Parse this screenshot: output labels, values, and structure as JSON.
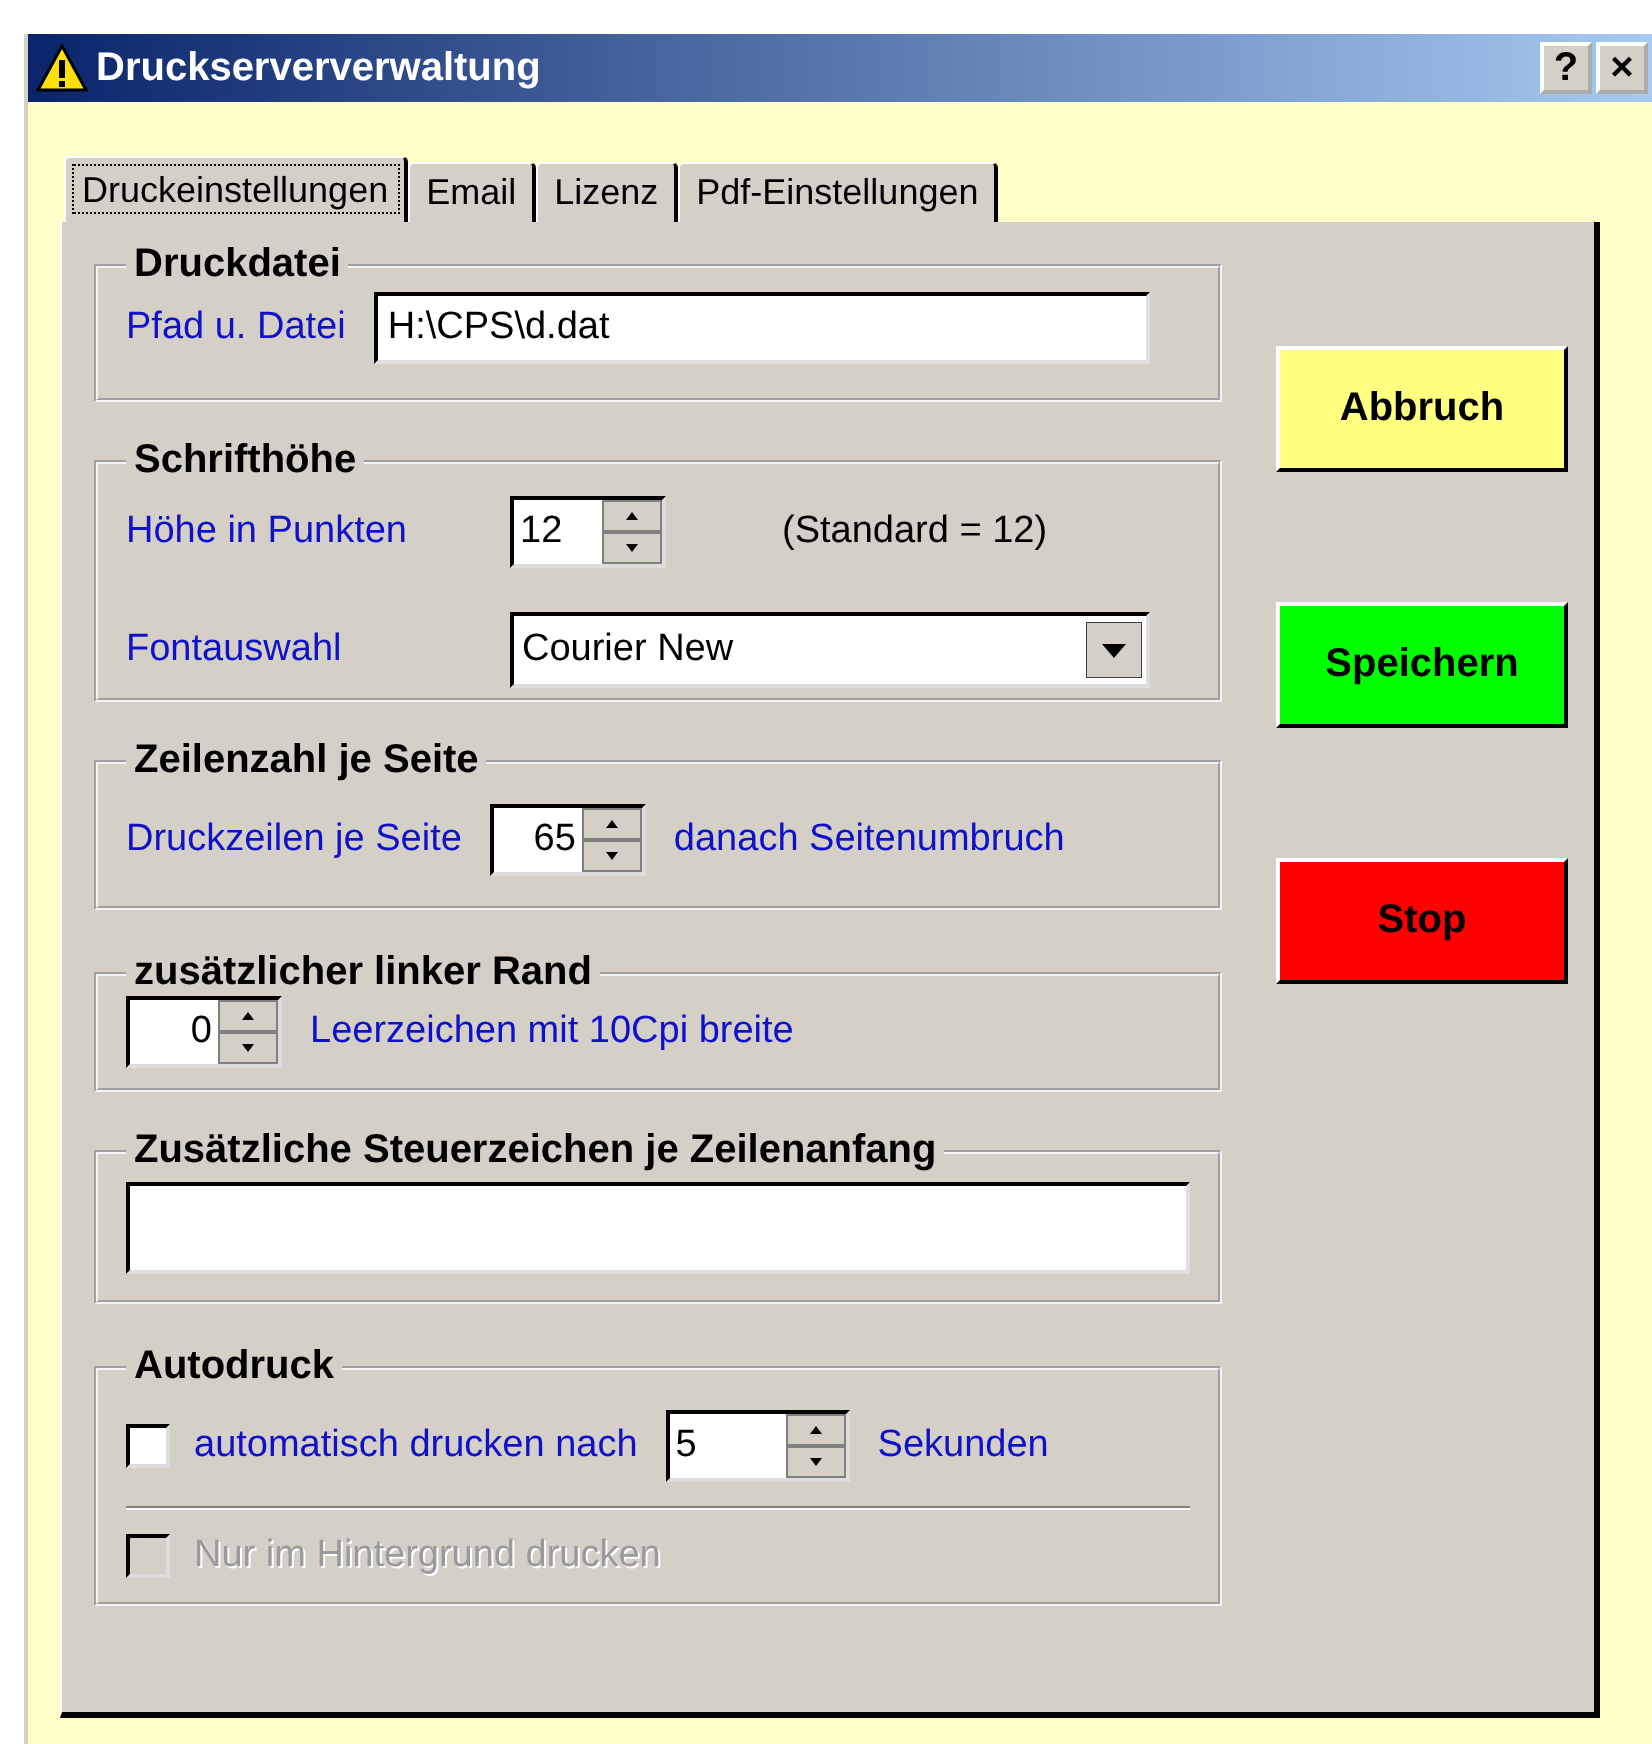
{
  "window": {
    "title": "Druckserververwaltung",
    "help": "?",
    "close": "×"
  },
  "tabs": [
    {
      "label": "Druckeinstellungen",
      "selected": true
    },
    {
      "label": "Email",
      "selected": false
    },
    {
      "label": "Lizenz",
      "selected": false
    },
    {
      "label": "Pdf-Einstellungen",
      "selected": false
    }
  ],
  "druckdatei": {
    "title": "Druckdatei",
    "label": "Pfad u. Datei",
    "value": "H:\\CPS\\d.dat"
  },
  "schrifthoehe": {
    "title": "Schrifthöhe",
    "size_label": "Höhe in Punkten",
    "size_value": "12",
    "size_hint": "(Standard = 12)",
    "font_label": "Fontauswahl",
    "font_value": "Courier New"
  },
  "zeilenzahl": {
    "title": "Zeilenzahl je Seite",
    "label": "Druckzeilen je Seite",
    "value": "65",
    "suffix": "danach Seitenumbruch"
  },
  "rand": {
    "title": "zusätzlicher linker Rand",
    "value": "0",
    "label": "Leerzeichen mit 10Cpi breite"
  },
  "steuerzeichen": {
    "title": "Zusätzliche Steuerzeichen je Zeilenanfang"
  },
  "autodruck": {
    "title": "Autodruck",
    "auto": {
      "label": "automatisch drucken nach",
      "checked": false
    },
    "delay": "5",
    "unit": "Sekunden",
    "background": {
      "label": "Nur im Hintergrund drucken",
      "checked": false,
      "disabled": true
    }
  },
  "buttons": [
    {
      "label": "Abbruch",
      "color": "#ffff80"
    },
    {
      "label": "Speichern",
      "color": "#00ff00"
    },
    {
      "label": "Stop",
      "color": "#ff0000"
    }
  ]
}
